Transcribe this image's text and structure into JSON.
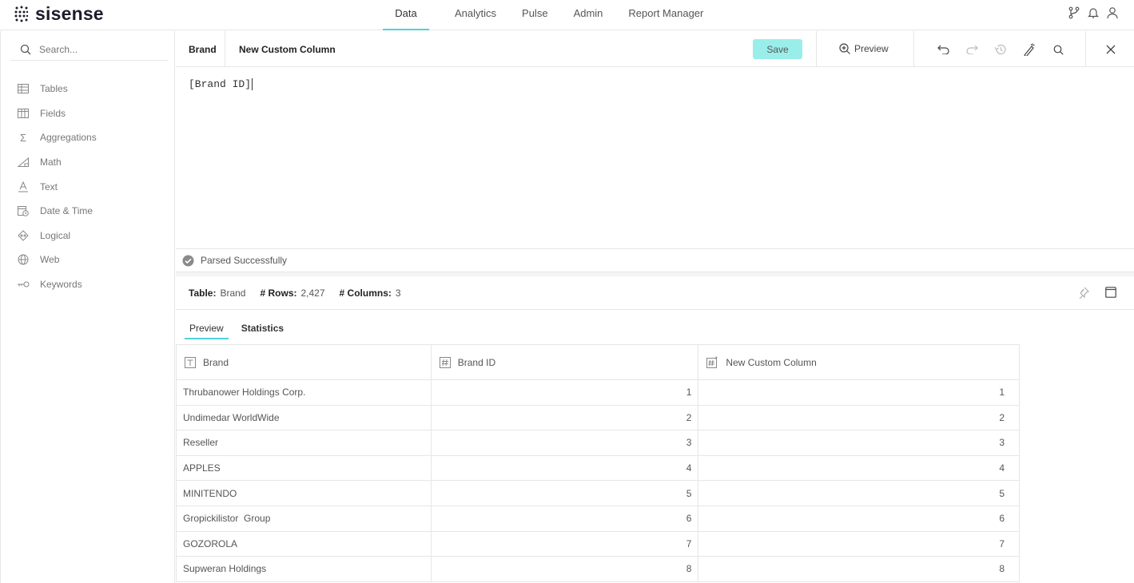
{
  "app": {
    "logo_text": "sisense",
    "brand_color": "#4fd1d9"
  },
  "nav": {
    "tabs": [
      {
        "label": "Data",
        "active": true
      },
      {
        "label": "Analytics"
      },
      {
        "label": "Pulse"
      },
      {
        "label": "Admin"
      },
      {
        "label": "Report Manager"
      }
    ],
    "icons": [
      "branch-icon",
      "bell-icon",
      "user-icon"
    ]
  },
  "sidebar": {
    "search_placeholder": "Search...",
    "items": [
      {
        "label": "Tables",
        "icon": "table-icon"
      },
      {
        "label": "Fields",
        "icon": "fields-icon"
      },
      {
        "label": "Aggregations",
        "icon": "sigma-icon"
      },
      {
        "label": "Math",
        "icon": "math-icon"
      },
      {
        "label": "Text",
        "icon": "text-icon"
      },
      {
        "label": "Date & Time",
        "icon": "calendar-clock-icon"
      },
      {
        "label": "Logical",
        "icon": "logical-icon"
      },
      {
        "label": "Web",
        "icon": "globe-icon"
      },
      {
        "label": "Keywords",
        "icon": "keywords-icon"
      }
    ]
  },
  "toolbar": {
    "table_name": "Brand",
    "column_name": "New Custom Column",
    "save_label": "Save",
    "preview_label": "Preview",
    "save_color": "#9aeeea"
  },
  "editor": {
    "code": "[Brand ID]"
  },
  "status": {
    "text": "Parsed Successfully"
  },
  "info": {
    "table_label": "Table:",
    "table_value": "Brand",
    "rows_label": "# Rows:",
    "rows_value": "2,427",
    "columns_label": "# Columns:",
    "columns_value": "3"
  },
  "tabs": [
    {
      "label": "Preview",
      "active": true
    },
    {
      "label": "Statistics"
    }
  ],
  "table": {
    "columns": [
      {
        "label": "Brand",
        "icon": "text-column-icon"
      },
      {
        "label": "Brand ID",
        "icon": "number-column-icon"
      },
      {
        "label": "New Custom Column",
        "icon": "custom-number-column-icon"
      }
    ],
    "rows": [
      [
        "Thrubanower Holdings Corp.",
        "1",
        "1"
      ],
      [
        "Undimedar WorldWide",
        "2",
        "2"
      ],
      [
        "Reseller",
        "3",
        "3"
      ],
      [
        "APPLES",
        "4",
        "4"
      ],
      [
        "MINITENDO",
        "5",
        "5"
      ],
      [
        "Gropickilistor  Group",
        "6",
        "6"
      ],
      [
        "GOZOROLA",
        "7",
        "7"
      ],
      [
        "Supweran Holdings",
        "8",
        "8"
      ]
    ]
  }
}
